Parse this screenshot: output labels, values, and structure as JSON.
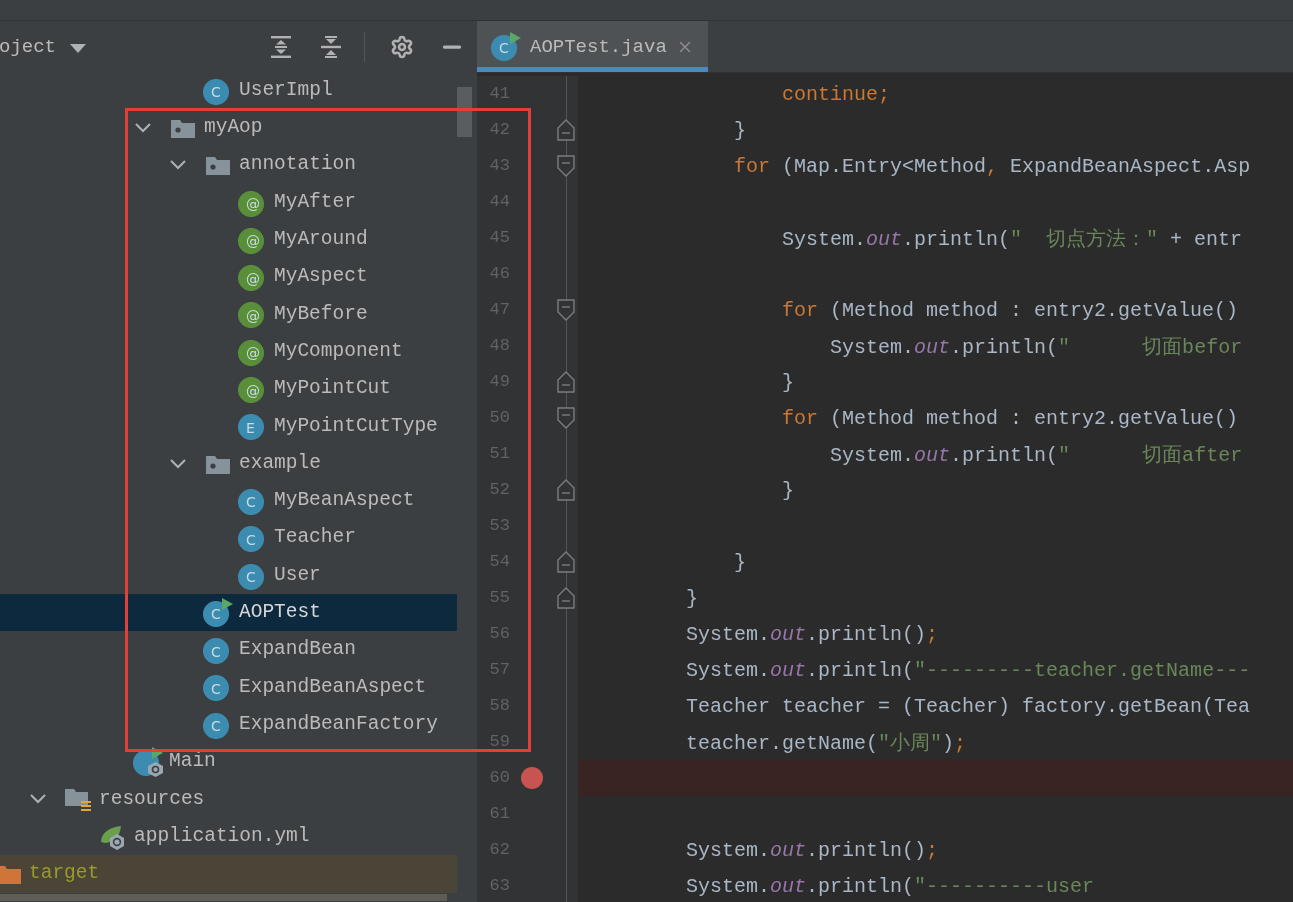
{
  "project_panel": {
    "title": "oject",
    "tree": {
      "items": [
        {
          "children": [
            {
              "children": [
                {
                  "children": [
                    {
                      "children": [
                        {
                          "children": [
                            {
                              "children": [
                                {
                                  "label": "UserImpl",
                                  "kind": "class",
                                  "badge": "C",
                                  "selected": false
                                }
                              ]
                            },
                            {
                              "label": "myAop",
                              "kind": "package",
                              "expanded": true,
                              "selected": false,
                              "children": [
                                {
                                  "label": "annotation",
                                  "kind": "package",
                                  "expanded": true,
                                  "selected": false,
                                  "children": [
                                    {
                                      "label": "MyAfter",
                                      "kind": "annotation",
                                      "badge": "@",
                                      "selected": false
                                    },
                                    {
                                      "label": "MyAround",
                                      "kind": "annotation",
                                      "badge": "@",
                                      "selected": false
                                    },
                                    {
                                      "label": "MyAspect",
                                      "kind": "annotation",
                                      "badge": "@",
                                      "selected": false
                                    },
                                    {
                                      "label": "MyBefore",
                                      "kind": "annotation",
                                      "badge": "@",
                                      "selected": false
                                    },
                                    {
                                      "label": "MyComponent",
                                      "kind": "annotation",
                                      "badge": "@",
                                      "selected": false
                                    },
                                    {
                                      "label": "MyPointCut",
                                      "kind": "annotation",
                                      "badge": "@",
                                      "selected": false
                                    },
                                    {
                                      "label": "MyPointCutType",
                                      "kind": "enum",
                                      "badge": "E",
                                      "selected": false
                                    }
                                  ]
                                },
                                {
                                  "label": "example",
                                  "kind": "package",
                                  "expanded": true,
                                  "selected": false,
                                  "children": [
                                    {
                                      "label": "MyBeanAspect",
                                      "kind": "class",
                                      "badge": "C",
                                      "selected": false
                                    },
                                    {
                                      "label": "Teacher",
                                      "kind": "class",
                                      "badge": "C",
                                      "selected": false
                                    },
                                    {
                                      "label": "User",
                                      "kind": "class",
                                      "badge": "C",
                                      "selected": false
                                    }
                                  ]
                                },
                                {
                                  "label": "AOPTest",
                                  "kind": "test-class",
                                  "badge": "C",
                                  "selected": true
                                },
                                {
                                  "label": "ExpandBean",
                                  "kind": "class",
                                  "badge": "C",
                                  "selected": false
                                },
                                {
                                  "label": "ExpandBeanAspect",
                                  "kind": "class",
                                  "badge": "C",
                                  "selected": false
                                },
                                {
                                  "label": "ExpandBeanFactory",
                                  "kind": "class",
                                  "badge": "C",
                                  "selected": false
                                }
                              ]
                            }
                          ]
                        },
                        {
                          "label": "Main",
                          "kind": "main-class",
                          "selected": false
                        }
                      ]
                    }
                  ]
                },
                {
                  "label": "resources",
                  "kind": "resources-folder",
                  "expanded": true,
                  "selected": false,
                  "children": [
                    {
                      "label": "application.yml",
                      "kind": "spring-config",
                      "selected": false
                    }
                  ]
                }
              ]
            }
          ]
        },
        {
          "label": "target",
          "kind": "excluded-folder",
          "selected": false
        }
      ]
    }
  },
  "editor": {
    "tabs": [
      {
        "label": "AOPTest.java",
        "kind": "test-class",
        "badge": "C",
        "selected": true
      }
    ],
    "lines": [
      {
        "number": "41",
        "breakpoint": false,
        "fold_start": false,
        "fold_end": false,
        "tokens": [
          {
            "kind": "keyword",
            "text": "                continue"
          },
          {
            "kind": "punct",
            "text": ";"
          }
        ]
      },
      {
        "number": "42",
        "breakpoint": false,
        "fold_start": false,
        "fold_end": true,
        "tokens": [
          {
            "kind": "plain",
            "text": "            }"
          }
        ]
      },
      {
        "number": "43",
        "breakpoint": false,
        "fold_start": true,
        "fold_end": false,
        "tokens": [
          {
            "kind": "keyword",
            "text": "            for"
          },
          {
            "kind": "plain",
            "text": " (Map.Entry<Method"
          },
          {
            "kind": "punct",
            "text": ","
          },
          {
            "kind": "plain",
            "text": " ExpandBeanAspect.Asp"
          }
        ]
      },
      {
        "number": "44",
        "breakpoint": false,
        "fold_start": false,
        "fold_end": false
      },
      {
        "number": "45",
        "breakpoint": false,
        "fold_start": false,
        "fold_end": false,
        "tokens": [
          {
            "kind": "plain",
            "text": "                System."
          },
          {
            "kind": "field",
            "text": "out"
          },
          {
            "kind": "plain",
            "text": ".println("
          },
          {
            "kind": "string",
            "text": "\"  切点方法：\""
          },
          {
            "kind": "plain",
            "text": " + entr"
          }
        ]
      },
      {
        "number": "46",
        "breakpoint": false,
        "fold_start": false,
        "fold_end": false
      },
      {
        "number": "47",
        "breakpoint": false,
        "fold_start": true,
        "fold_end": false,
        "tokens": [
          {
            "kind": "keyword",
            "text": "                for"
          },
          {
            "kind": "plain",
            "text": " (Method method : entry2.getValue()"
          }
        ]
      },
      {
        "number": "48",
        "breakpoint": false,
        "fold_start": false,
        "fold_end": false,
        "tokens": [
          {
            "kind": "plain",
            "text": "                    System."
          },
          {
            "kind": "field",
            "text": "out"
          },
          {
            "kind": "plain",
            "text": ".println("
          },
          {
            "kind": "string",
            "text": "\"      切面befor"
          }
        ]
      },
      {
        "number": "49",
        "breakpoint": false,
        "fold_start": false,
        "fold_end": true,
        "tokens": [
          {
            "kind": "plain",
            "text": "                }"
          }
        ]
      },
      {
        "number": "50",
        "breakpoint": false,
        "fold_start": true,
        "fold_end": false,
        "tokens": [
          {
            "kind": "keyword",
            "text": "                for"
          },
          {
            "kind": "plain",
            "text": " (Method method : entry2.getValue()"
          }
        ]
      },
      {
        "number": "51",
        "breakpoint": false,
        "fold_start": false,
        "fold_end": false,
        "tokens": [
          {
            "kind": "plain",
            "text": "                    System."
          },
          {
            "kind": "field",
            "text": "out"
          },
          {
            "kind": "plain",
            "text": ".println("
          },
          {
            "kind": "string",
            "text": "\"      切面after"
          }
        ]
      },
      {
        "number": "52",
        "breakpoint": false,
        "fold_start": false,
        "fold_end": true,
        "tokens": [
          {
            "kind": "plain",
            "text": "                }"
          }
        ]
      },
      {
        "number": "53",
        "breakpoint": false,
        "fold_start": false,
        "fold_end": false
      },
      {
        "number": "54",
        "breakpoint": false,
        "fold_start": false,
        "fold_end": true,
        "tokens": [
          {
            "kind": "plain",
            "text": "            }"
          }
        ]
      },
      {
        "number": "55",
        "breakpoint": false,
        "fold_start": false,
        "fold_end": true,
        "tokens": [
          {
            "kind": "plain",
            "text": "        }"
          }
        ]
      },
      {
        "number": "56",
        "breakpoint": false,
        "fold_start": false,
        "fold_end": false,
        "tokens": [
          {
            "kind": "plain",
            "text": "        System."
          },
          {
            "kind": "field",
            "text": "out"
          },
          {
            "kind": "plain",
            "text": ".println()"
          },
          {
            "kind": "punct",
            "text": ";"
          }
        ]
      },
      {
        "number": "57",
        "breakpoint": false,
        "fold_start": false,
        "fold_end": false,
        "tokens": [
          {
            "kind": "plain",
            "text": "        System."
          },
          {
            "kind": "field",
            "text": "out"
          },
          {
            "kind": "plain",
            "text": ".println("
          },
          {
            "kind": "string",
            "text": "\"---------teacher.getName---"
          }
        ]
      },
      {
        "number": "58",
        "breakpoint": false,
        "fold_start": false,
        "fold_end": false,
        "tokens": [
          {
            "kind": "plain",
            "text": "        Teacher teacher = (Teacher) factory.getBean(Tea"
          }
        ]
      },
      {
        "number": "59",
        "breakpoint": false,
        "fold_start": false,
        "fold_end": false,
        "tokens": [
          {
            "kind": "plain",
            "text": "        teacher.getName("
          },
          {
            "kind": "string",
            "text": "\"小周\""
          },
          {
            "kind": "plain",
            "text": ")"
          },
          {
            "kind": "punct",
            "text": ";"
          }
        ]
      },
      {
        "number": "60",
        "breakpoint": true,
        "fold_start": false,
        "fold_end": false
      },
      {
        "number": "61",
        "breakpoint": false,
        "fold_start": false,
        "fold_end": false
      },
      {
        "number": "62",
        "breakpoint": false,
        "fold_start": false,
        "fold_end": false,
        "tokens": [
          {
            "kind": "plain",
            "text": "        System."
          },
          {
            "kind": "field",
            "text": "out"
          },
          {
            "kind": "plain",
            "text": ".println()"
          },
          {
            "kind": "punct",
            "text": ";"
          }
        ]
      },
      {
        "number": "63",
        "breakpoint": false,
        "fold_start": false,
        "fold_end": false,
        "tokens": [
          {
            "kind": "plain",
            "text": "        System."
          },
          {
            "kind": "field",
            "text": "out"
          },
          {
            "kind": "plain",
            "text": ".println("
          },
          {
            "kind": "string",
            "text": "\"----------user"
          }
        ]
      }
    ]
  }
}
